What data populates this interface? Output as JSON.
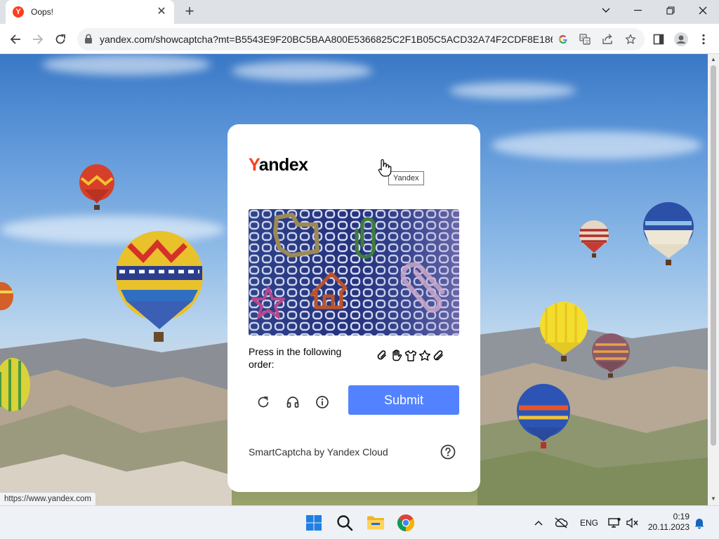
{
  "browser": {
    "tab_title": "Oops!",
    "tab_favicon_letter": "Y",
    "address": "yandex.com/showcaptcha?mt=B5543E9F20BC5BAA800E5366825C2F1B05C5ACD32A74F2CDF8E18663...",
    "icons": [
      "back-icon",
      "forward-icon",
      "reload-icon",
      "lock-icon",
      "google-icon",
      "translate-icon",
      "share-icon",
      "star-icon",
      "sidepanel-icon",
      "profile-icon",
      "menu-icon",
      "minimize-icon",
      "maximize-icon",
      "close-icon",
      "tab-search-icon"
    ],
    "status_url": "https://www.yandex.com"
  },
  "captcha": {
    "logo_first": "Y",
    "logo_rest": "andex",
    "tooltip": "Yandex",
    "instruction": "Press in the following order:",
    "hint_icons": [
      "paperclip-icon",
      "hand-icon",
      "tshirt-icon",
      "star-icon",
      "paperclip-icon"
    ],
    "submit_label": "Submit",
    "controls": [
      "refresh-icon",
      "audio-icon",
      "info-icon"
    ],
    "footer": "SmartCaptcha by Yandex Cloud",
    "accent_color": "#5282ff",
    "brand_color": "#fc3f1d"
  },
  "taskbar": {
    "apps": [
      "windows-start-icon",
      "search-icon",
      "file-explorer-icon",
      "chrome-icon"
    ],
    "language": "ENG",
    "time": "0:19",
    "date": "20.11.2023"
  }
}
